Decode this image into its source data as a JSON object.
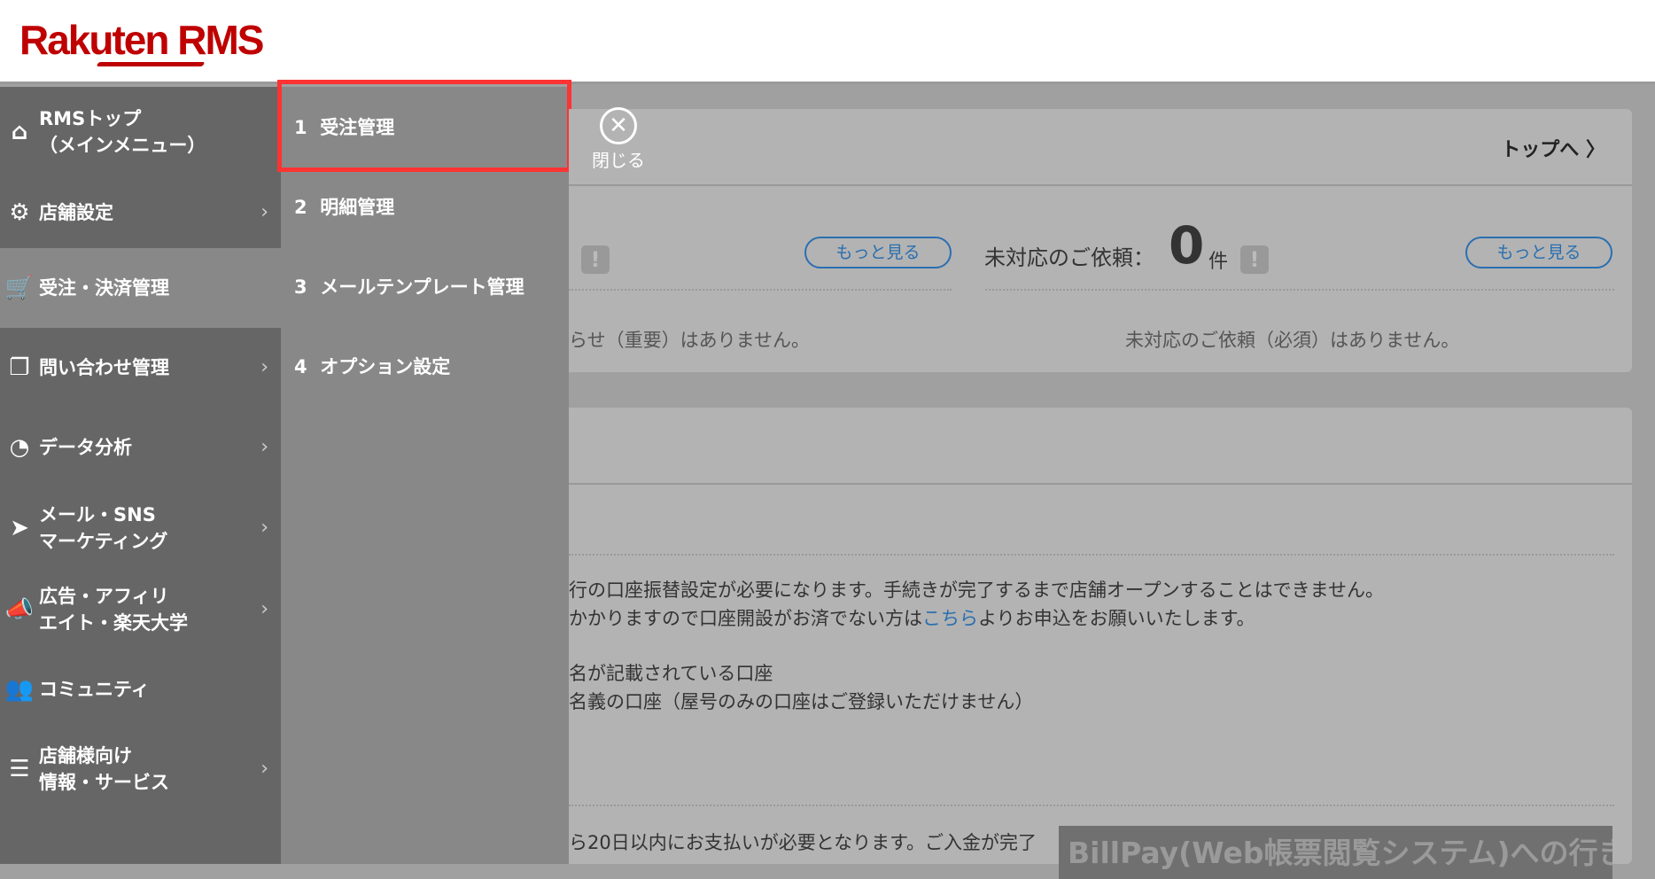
{
  "logo": "Rakuten RMS",
  "sidebar": {
    "items": [
      {
        "label1": "RMSトップ",
        "label2": "（メインメニュー）",
        "icon": "home-icon"
      },
      {
        "label1": "店舗設定",
        "icon": "gear-icon"
      },
      {
        "label1": "受注・決済管理",
        "icon": "cart-icon"
      },
      {
        "label1": "問い合わせ管理",
        "icon": "chat-icon"
      },
      {
        "label1": "データ分析",
        "icon": "pie-chart-icon"
      },
      {
        "label1": "メール・SNS",
        "label2": "マーケティング",
        "icon": "paper-plane-icon"
      },
      {
        "label1": "広告・アフィリ",
        "label2": "エイト・楽天大学",
        "icon": "megaphone-icon"
      },
      {
        "label1": "コミュニティ",
        "icon": "people-icon"
      },
      {
        "label1": "店舗様向け",
        "label2": "情報・サービス",
        "icon": "list-icon"
      }
    ]
  },
  "submenu": {
    "items": [
      {
        "num": "1",
        "label": "受注管理"
      },
      {
        "num": "2",
        "label": "明細管理"
      },
      {
        "num": "3",
        "label": "メールテンプレート管理"
      },
      {
        "num": "4",
        "label": "オプション設定"
      }
    ]
  },
  "card1": {
    "close": "閉じる",
    "to_top": "トップへ",
    "more": "もっと見る",
    "requests_label": "未対応のご依頼：",
    "requests_count": "0",
    "requests_unit": "件",
    "notice_empty": "らせ（重要）はありません。",
    "requests_empty": "未対応のご依頼（必須）はありません。"
  },
  "card2": {
    "line1": "行の口座振替設定が必要になります。手続きが完了するまで店舗オープンすることはできません。",
    "line2a": "かかりますので口座開設がお済でない方は",
    "line2_link": "こちら",
    "line2b": "よりお申込をお願いいたします。",
    "line3": "名が記載されている口座",
    "line4": "名義の口座（屋号のみの口座はご登録いただけません）",
    "line5": "ら20日以内にお支払いが必要となります。ご入金が完了",
    "billpay": "BillPay(Web帳票閲覧システム)への行き方"
  }
}
